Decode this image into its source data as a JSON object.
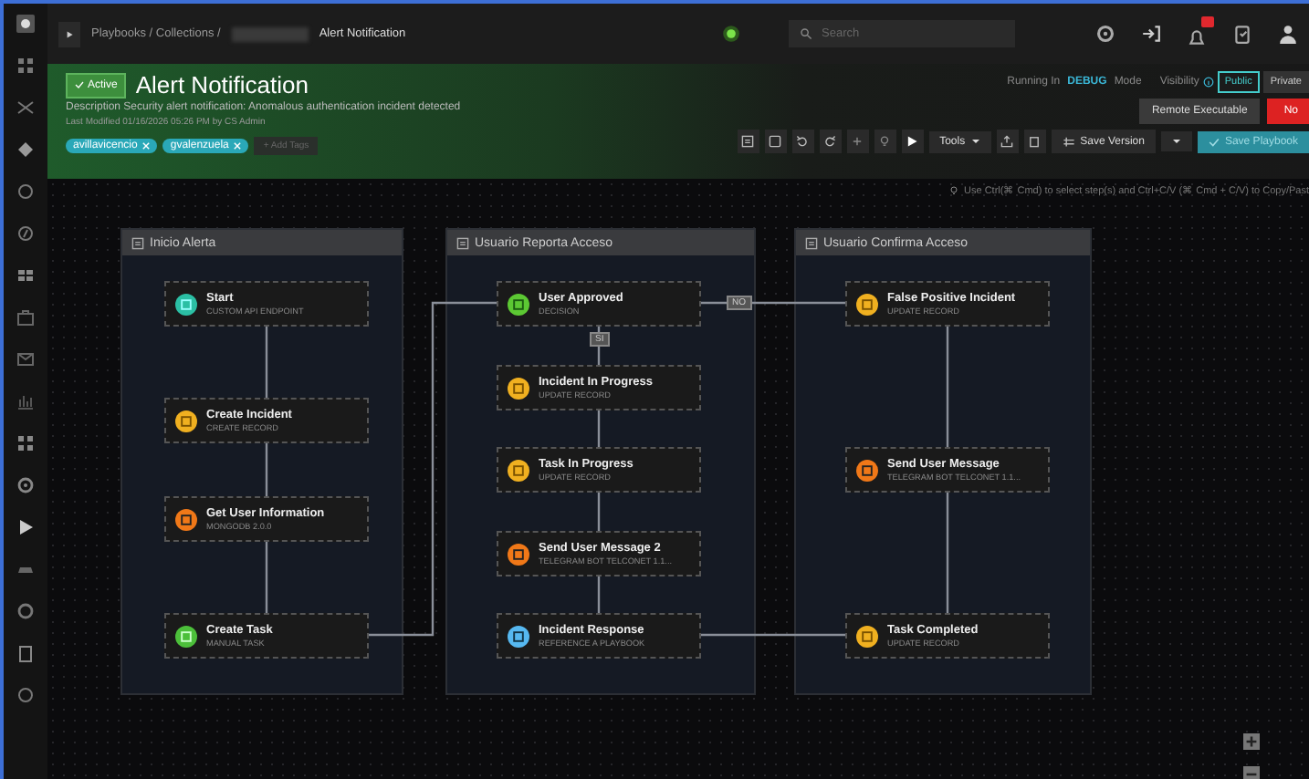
{
  "topbar": {
    "breadcrumb": "Playbooks / Collections /",
    "page": "Alert Notification",
    "search": {
      "placeholder": "Search"
    }
  },
  "playbook": {
    "status": {
      "label": "Active",
      "on": true
    },
    "title": "Alert Notification",
    "description_label": "Description",
    "description": "Security alert notification: Anomalous authentication incident detected",
    "last_modified": "Last Modified 01/16/2026 05:26 PM by CS Admin",
    "tags": [
      "avillavicencio",
      "gvalenzuela"
    ],
    "add_tags": "+ Add Tags",
    "mode": {
      "prefix": "Running In",
      "value": "DEBUG",
      "suffix": "Mode"
    },
    "visibility": {
      "label": "Visibility",
      "options": [
        {
          "label": "Public",
          "selected": true
        },
        {
          "label": "Private",
          "selected": false
        }
      ]
    },
    "remote_executable": "Remote Executable",
    "danger_button": "No",
    "toolbar": {
      "tools": "Tools",
      "save_version": "Save Version",
      "save_playbook": "Save Playbook"
    }
  },
  "hint": "Use Ctrl(⌘ Cmd) to select step(s) and Ctrl+C/V (⌘ Cmd + C/V) to Copy/Past",
  "lanes": [
    {
      "title": "Inicio Alerta",
      "steps": [
        {
          "name": "Start",
          "subtitle": "CUSTOM API ENDPOINT",
          "kind": "start"
        },
        {
          "name": "Create Incident",
          "subtitle": "CREATE RECORD",
          "kind": "record"
        },
        {
          "name": "Get User Information",
          "subtitle": "MONGODB 2.0.0",
          "kind": "connector"
        },
        {
          "name": "Create Task",
          "subtitle": "MANUAL TASK",
          "kind": "manual"
        }
      ]
    },
    {
      "title": "Usuario Reporta Acceso",
      "steps": [
        {
          "name": "User Approved",
          "subtitle": "DECISION",
          "kind": "decision"
        },
        {
          "name": "Incident In Progress",
          "subtitle": "UPDATE RECORD",
          "kind": "record"
        },
        {
          "name": "Task In Progress",
          "subtitle": "UPDATE RECORD",
          "kind": "record"
        },
        {
          "name": "Send User Message 2",
          "subtitle": "TELEGRAM BOT TELCONET 1.1...",
          "kind": "connector"
        },
        {
          "name": "Incident Response",
          "subtitle": "REFERENCE A PLAYBOOK",
          "kind": "reference"
        }
      ]
    },
    {
      "title": "Usuario Confirma Acceso",
      "steps": [
        {
          "name": "False Positive Incident",
          "subtitle": "UPDATE RECORD",
          "kind": "record"
        },
        {
          "name": "Send User Message",
          "subtitle": "TELEGRAM BOT TELCONET 1.1...",
          "kind": "connector"
        },
        {
          "name": "Task Completed",
          "subtitle": "UPDATE RECORD",
          "kind": "record"
        }
      ]
    }
  ],
  "branches": [
    {
      "label": "NO"
    },
    {
      "label": "SI"
    }
  ]
}
